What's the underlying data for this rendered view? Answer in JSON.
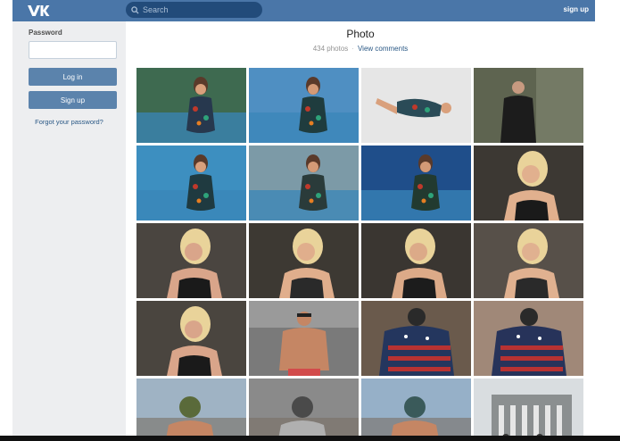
{
  "topbar": {
    "logo_text": "VK",
    "search_placeholder": "Search",
    "signup_label": "sign up",
    "brand_color": "#4a76a8"
  },
  "sidebar": {
    "password_label": "Password",
    "login_label": "Log in",
    "signup_label": "Sign up",
    "forgot_label": "Forgot your password?"
  },
  "main": {
    "title": "Photo",
    "photo_count": "434 photos",
    "separator": "·",
    "view_comments": "View comments"
  },
  "photos": [
    {
      "kind": "pool-floral",
      "bg": "#3e6a50",
      "accent": "#27384e",
      "skin": "#d9a07c"
    },
    {
      "kind": "pool-floral",
      "bg": "#4f8fc2",
      "accent": "#1f3c3e",
      "skin": "#d49a76"
    },
    {
      "kind": "lying-white",
      "bg": "#e6e6e6",
      "accent": "#2a4b57",
      "skin": "#d9a07c"
    },
    {
      "kind": "dark-coat",
      "bg": "#5e6450",
      "accent": "#1c1c1c",
      "skin": "#c79a80"
    },
    {
      "kind": "pool-floral",
      "bg": "#3d8fc0",
      "accent": "#1f3a40",
      "skin": "#d9a07c"
    },
    {
      "kind": "pool-floral",
      "bg": "#7c9aa7",
      "accent": "#2a3b3a",
      "skin": "#d49a76"
    },
    {
      "kind": "pool-floral",
      "bg": "#1f4e8a",
      "accent": "#223a30",
      "skin": "#d49a76"
    },
    {
      "kind": "blonde",
      "bg": "#3c3833",
      "accent": "#1a1a1a",
      "skin": "#e1b08e"
    },
    {
      "kind": "blonde",
      "bg": "#4a4540",
      "accent": "#1a1a1a",
      "skin": "#d9a58a"
    },
    {
      "kind": "blonde",
      "bg": "#3d3933",
      "accent": "#2a2a2a",
      "skin": "#e0ae8c"
    },
    {
      "kind": "blonde",
      "bg": "#3a3631",
      "accent": "#1c1c1c",
      "skin": "#dcaa88"
    },
    {
      "kind": "blonde",
      "bg": "#575049",
      "accent": "#2a2a2a",
      "skin": "#e0b190"
    },
    {
      "kind": "blonde",
      "bg": "#4a453f",
      "accent": "#1a1a1a",
      "skin": "#d9a58a"
    },
    {
      "kind": "shirtless",
      "bg": "#7a7a7a",
      "accent": "#8f5a3f",
      "skin": "#c58664"
    },
    {
      "kind": "flag-shirt",
      "bg": "#6a5a4c",
      "accent": "#24365e",
      "skin": "#c58664"
    },
    {
      "kind": "flag-shirt",
      "bg": "#a08878",
      "accent": "#27335a",
      "skin": "#c58664"
    },
    {
      "kind": "masked",
      "bg": "#9fb3c4",
      "accent": "#5a6a3a",
      "skin": "#c58664"
    },
    {
      "kind": "masked",
      "bg": "#8a8a8a",
      "accent": "#4a4a4a",
      "skin": "#b0b0b0"
    },
    {
      "kind": "masked",
      "bg": "#96b0c8",
      "accent": "#3a5a5a",
      "skin": "#c58664"
    },
    {
      "kind": "building",
      "bg": "#d9dde0",
      "accent": "#8b8f90",
      "skin": "#c58664"
    }
  ]
}
